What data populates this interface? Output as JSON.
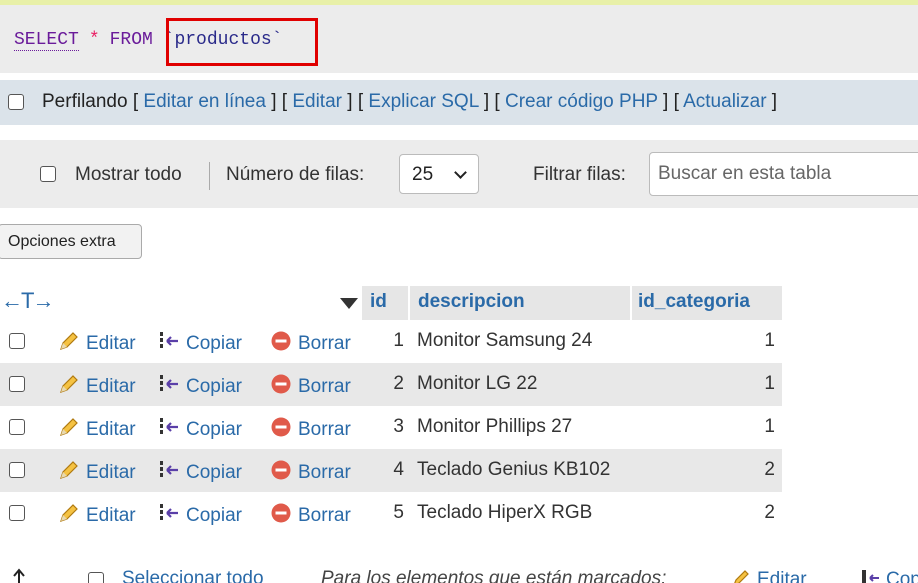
{
  "sql": {
    "select": "SELECT",
    "star": "*",
    "from": "FROM",
    "table": "`productos`"
  },
  "profiling": {
    "label": "Perfilando",
    "links": [
      "Editar en línea",
      "Editar",
      "Explicar SQL",
      "Crear código PHP",
      "Actualizar"
    ]
  },
  "navigation": {
    "show_all": "Mostrar todo",
    "rows_label": "Número de filas:",
    "rows_value": "25",
    "filter_label": "Filtrar filas:",
    "search_placeholder": "Buscar en esta tabla"
  },
  "extra_options": "Opciones extra",
  "table": {
    "columns": [
      "id",
      "descripcion",
      "id_categoria"
    ],
    "actions": {
      "edit": "Editar",
      "copy": "Copiar",
      "delete": "Borrar"
    },
    "rows": [
      {
        "id": "1",
        "descripcion": "Monitor Samsung 24",
        "id_categoria": "1"
      },
      {
        "id": "2",
        "descripcion": "Monitor LG 22",
        "id_categoria": "1"
      },
      {
        "id": "3",
        "descripcion": "Monitor Phillips 27",
        "id_categoria": "1"
      },
      {
        "id": "4",
        "descripcion": "Teclado Genius KB102",
        "id_categoria": "2"
      },
      {
        "id": "5",
        "descripcion": "Teclado HiperX RGB",
        "id_categoria": "2"
      }
    ]
  },
  "bottom": {
    "select_all": "Seleccionar todo",
    "marked": "Para los elementos que están marcados:",
    "edit": "Editar",
    "copy": "Copiar"
  },
  "colors": {
    "link": "#2a6aa8",
    "keyword": "#6a1b9a",
    "highlight_box": "#e00000"
  },
  "icons": [
    "pencil-icon",
    "copy-icon",
    "delete-icon",
    "sort-desc-icon",
    "up-arrow-icon"
  ]
}
